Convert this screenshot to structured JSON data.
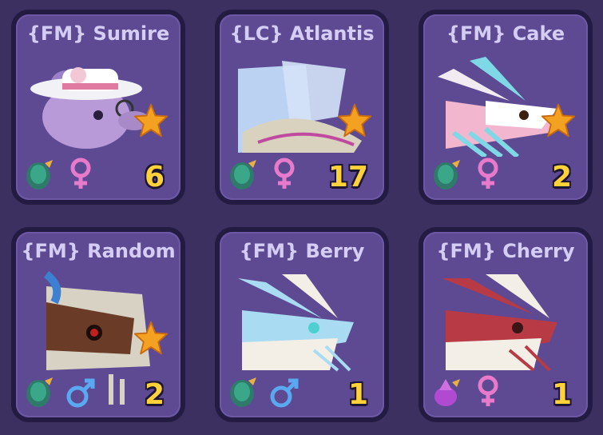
{
  "pets": [
    {
      "title": "{FM} Sumire",
      "count": "6",
      "gender": "female",
      "egg": "ocean-egg",
      "art": "white-hat-creature",
      "accent": "#b89ad8"
    },
    {
      "title": "{LC} Atlantis",
      "count": "17",
      "gender": "female",
      "egg": "ocean-egg",
      "art": "pale-blue-tail-creature",
      "accent": "#bcd2f2"
    },
    {
      "title": "{FM} Cake",
      "count": "2",
      "gender": "female",
      "egg": "ocean-egg",
      "art": "pink-teal-dragon",
      "accent": "#7fd8e6"
    },
    {
      "title": "{FM} Random",
      "count": "2",
      "gender": "male",
      "egg": "ocean-egg",
      "art": "brown-horned-creature",
      "accent": "#6a3b26"
    },
    {
      "title": "{FM} Berry",
      "count": "1",
      "gender": "male",
      "egg": "ocean-egg",
      "art": "light-blue-dragon",
      "accent": "#a9dcf2"
    },
    {
      "title": "{FM} Cherry",
      "count": "1",
      "gender": "female",
      "egg": "purple-dragon-egg",
      "art": "red-white-dragon",
      "accent": "#b83a45"
    }
  ],
  "colors": {
    "background": "#3b305f",
    "card": "#5d4a93",
    "title_text": "#d6cdf4",
    "count_text": "#ffd23a",
    "star": "#f4a020",
    "female": "#e87acb",
    "male": "#5aa8f0"
  }
}
